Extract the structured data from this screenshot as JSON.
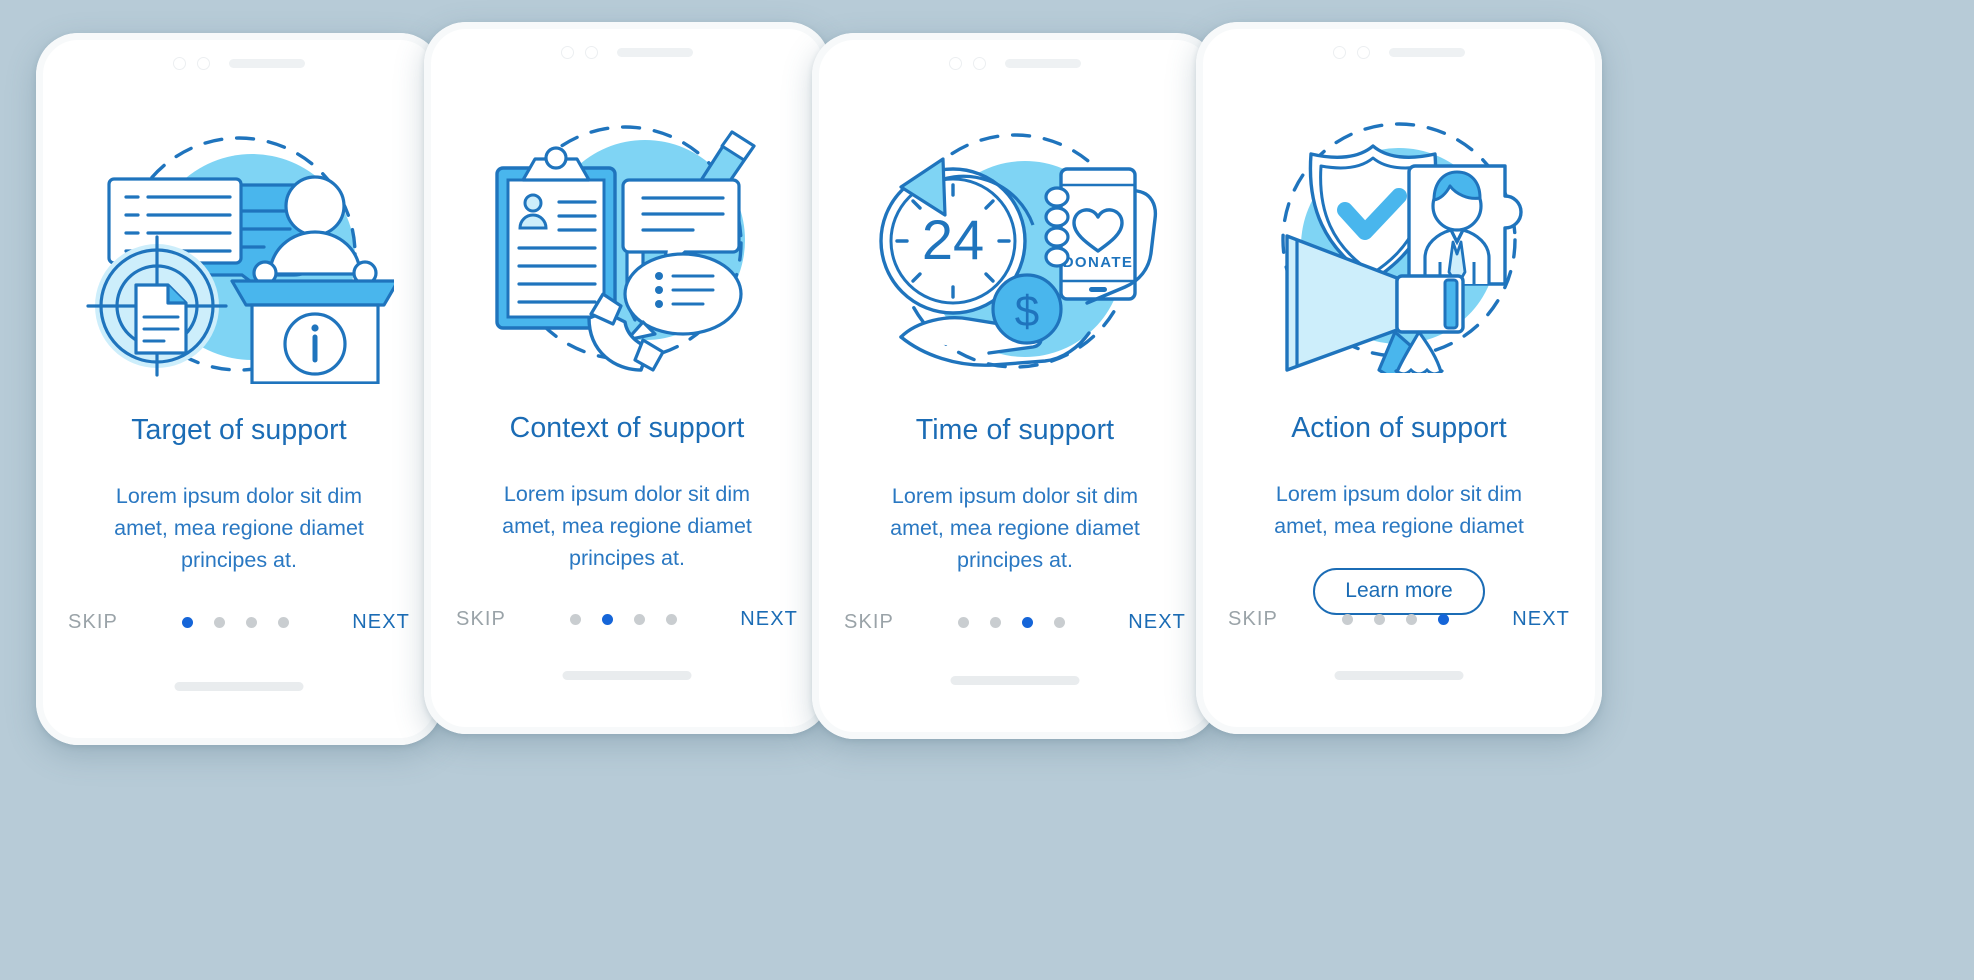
{
  "background_color": "#b7cbd7",
  "palette": {
    "title_blue": "#1b6cb5",
    "body_blue": "#2a78c2",
    "accent_dot": "#1565d8",
    "inactive_dot": "#c9cdd0",
    "skip_gray": "#9aa3a8",
    "illu_line": "#1f74bd",
    "illu_light": "#7fd4f4",
    "illu_pale": "#cdeefb",
    "illu_mid": "#49b6ed"
  },
  "screens": [
    {
      "id": "target-of-support",
      "title": "Target of support",
      "body_lines": [
        "Lorem ipsum dolor sit dim",
        "amet, mea regione diamet",
        "principes at."
      ],
      "skip_label": "SKIP",
      "next_label": "NEXT",
      "dots": 4,
      "active_dot": 1,
      "has_learn_more": false,
      "learn_more_label": "",
      "illustration": "speech-bubbles-podium-target-document"
    },
    {
      "id": "context-of-support",
      "title": "Context of support",
      "body_lines": [
        "Lorem ipsum dolor sit dim",
        "amet, mea regione diamet",
        "principes at."
      ],
      "skip_label": "SKIP",
      "next_label": "NEXT",
      "dots": 4,
      "active_dot": 2,
      "has_learn_more": false,
      "learn_more_label": "",
      "illustration": "clipboard-pen-pencil-speech-phone"
    },
    {
      "id": "time-of-support",
      "title": "Time of support",
      "body_lines": [
        "Lorem ipsum dolor sit dim",
        "amet, mea regione diamet",
        "principes at."
      ],
      "skip_label": "SKIP",
      "next_label": "NEXT",
      "dots": 4,
      "active_dot": 3,
      "has_learn_more": false,
      "learn_more_label": "",
      "illustration": "clock-24-donate-phone-coin-hand",
      "illustration_text": {
        "clock": "24",
        "donate": "DONATE",
        "coin": "$"
      }
    },
    {
      "id": "action-of-support",
      "title": "Action of support",
      "body_lines": [
        "Lorem ipsum dolor sit dim",
        "amet, mea regione diamet"
      ],
      "skip_label": "SKIP",
      "next_label": "NEXT",
      "dots": 4,
      "active_dot": 4,
      "has_learn_more": true,
      "learn_more_label": "Learn more",
      "illustration": "shield-check-puzzle-person-megaphone"
    }
  ]
}
